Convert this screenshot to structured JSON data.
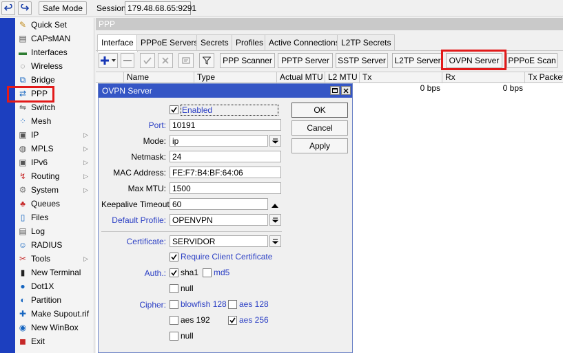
{
  "topbar": {
    "safe_mode_label": "Safe Mode",
    "session_label": "Session:",
    "session_value": "179.48.68.65:9291"
  },
  "sidebar": {
    "items": [
      {
        "label": "Quick Set",
        "icon": "quick-set-icon"
      },
      {
        "label": "CAPsMAN",
        "icon": "capsman-icon"
      },
      {
        "label": "Interfaces",
        "icon": "interfaces-icon"
      },
      {
        "label": "Wireless",
        "icon": "wireless-icon"
      },
      {
        "label": "Bridge",
        "icon": "bridge-icon"
      },
      {
        "label": "PPP",
        "icon": "ppp-icon"
      },
      {
        "label": "Switch",
        "icon": "switch-icon"
      },
      {
        "label": "Mesh",
        "icon": "mesh-icon"
      },
      {
        "label": "IP",
        "icon": "ip-icon",
        "submenu": true
      },
      {
        "label": "MPLS",
        "icon": "mpls-icon",
        "submenu": true
      },
      {
        "label": "IPv6",
        "icon": "ipv6-icon",
        "submenu": true
      },
      {
        "label": "Routing",
        "icon": "routing-icon",
        "submenu": true
      },
      {
        "label": "System",
        "icon": "system-icon",
        "submenu": true
      },
      {
        "label": "Queues",
        "icon": "queues-icon"
      },
      {
        "label": "Files",
        "icon": "files-icon"
      },
      {
        "label": "Log",
        "icon": "log-icon"
      },
      {
        "label": "RADIUS",
        "icon": "radius-icon"
      },
      {
        "label": "Tools",
        "icon": "tools-icon",
        "submenu": true
      },
      {
        "label": "New Terminal",
        "icon": "terminal-icon"
      },
      {
        "label": "Dot1X",
        "icon": "dot1x-icon"
      },
      {
        "label": "Partition",
        "icon": "partition-icon"
      },
      {
        "label": "Make Supout.rif",
        "icon": "supout-icon"
      },
      {
        "label": "New WinBox",
        "icon": "winbox-icon"
      },
      {
        "label": "Exit",
        "icon": "exit-icon"
      }
    ]
  },
  "ppp": {
    "title": "PPP",
    "tabs": [
      "Interface",
      "PPPoE Servers",
      "Secrets",
      "Profiles",
      "Active Connections",
      "L2TP Secrets"
    ],
    "toolbar": [
      "PPP Scanner",
      "PPTP Server",
      "SSTP Server",
      "L2TP Server",
      "OVPN Server",
      "PPPoE Scan"
    ],
    "columns": [
      "Name",
      "Type",
      "Actual MTU",
      "L2 MTU",
      "Tx",
      "Rx",
      "Tx Packet ("
    ],
    "row": {
      "tx": "0 bps",
      "rx": "0 bps"
    }
  },
  "dialog": {
    "title": "OVPN Server",
    "enabled_label": "Enabled",
    "enabled": true,
    "port_label": "Port:",
    "port": "10191",
    "mode_label": "Mode:",
    "mode": "ip",
    "netmask_label": "Netmask:",
    "netmask": "24",
    "mac_label": "MAC Address:",
    "mac": "FE:F7:B4:BF:64:06",
    "maxmtu_label": "Max MTU:",
    "maxmtu": "1500",
    "keepalive_label": "Keepalive Timeout:",
    "keepalive": "60",
    "profile_label": "Default Profile:",
    "profile": "OPENVPN",
    "cert_label": "Certificate:",
    "cert": "SERVIDOR",
    "require_cert_label": "Require Client Certificate",
    "auth_label": "Auth.:",
    "auth": {
      "sha1": "sha1",
      "md5": "md5",
      "null": "null"
    },
    "cipher_label": "Cipher:",
    "cipher": {
      "blowfish": "blowfish 128",
      "aes128": "aes 128",
      "aes192": "aes 192",
      "aes256": "aes 256",
      "null": "null"
    },
    "ok": "OK",
    "cancel": "Cancel",
    "apply": "Apply"
  },
  "colors": {
    "highlight": "#e21a1a",
    "dialog_title": "#3556c5",
    "field_label_link": "#2b3fc4"
  }
}
